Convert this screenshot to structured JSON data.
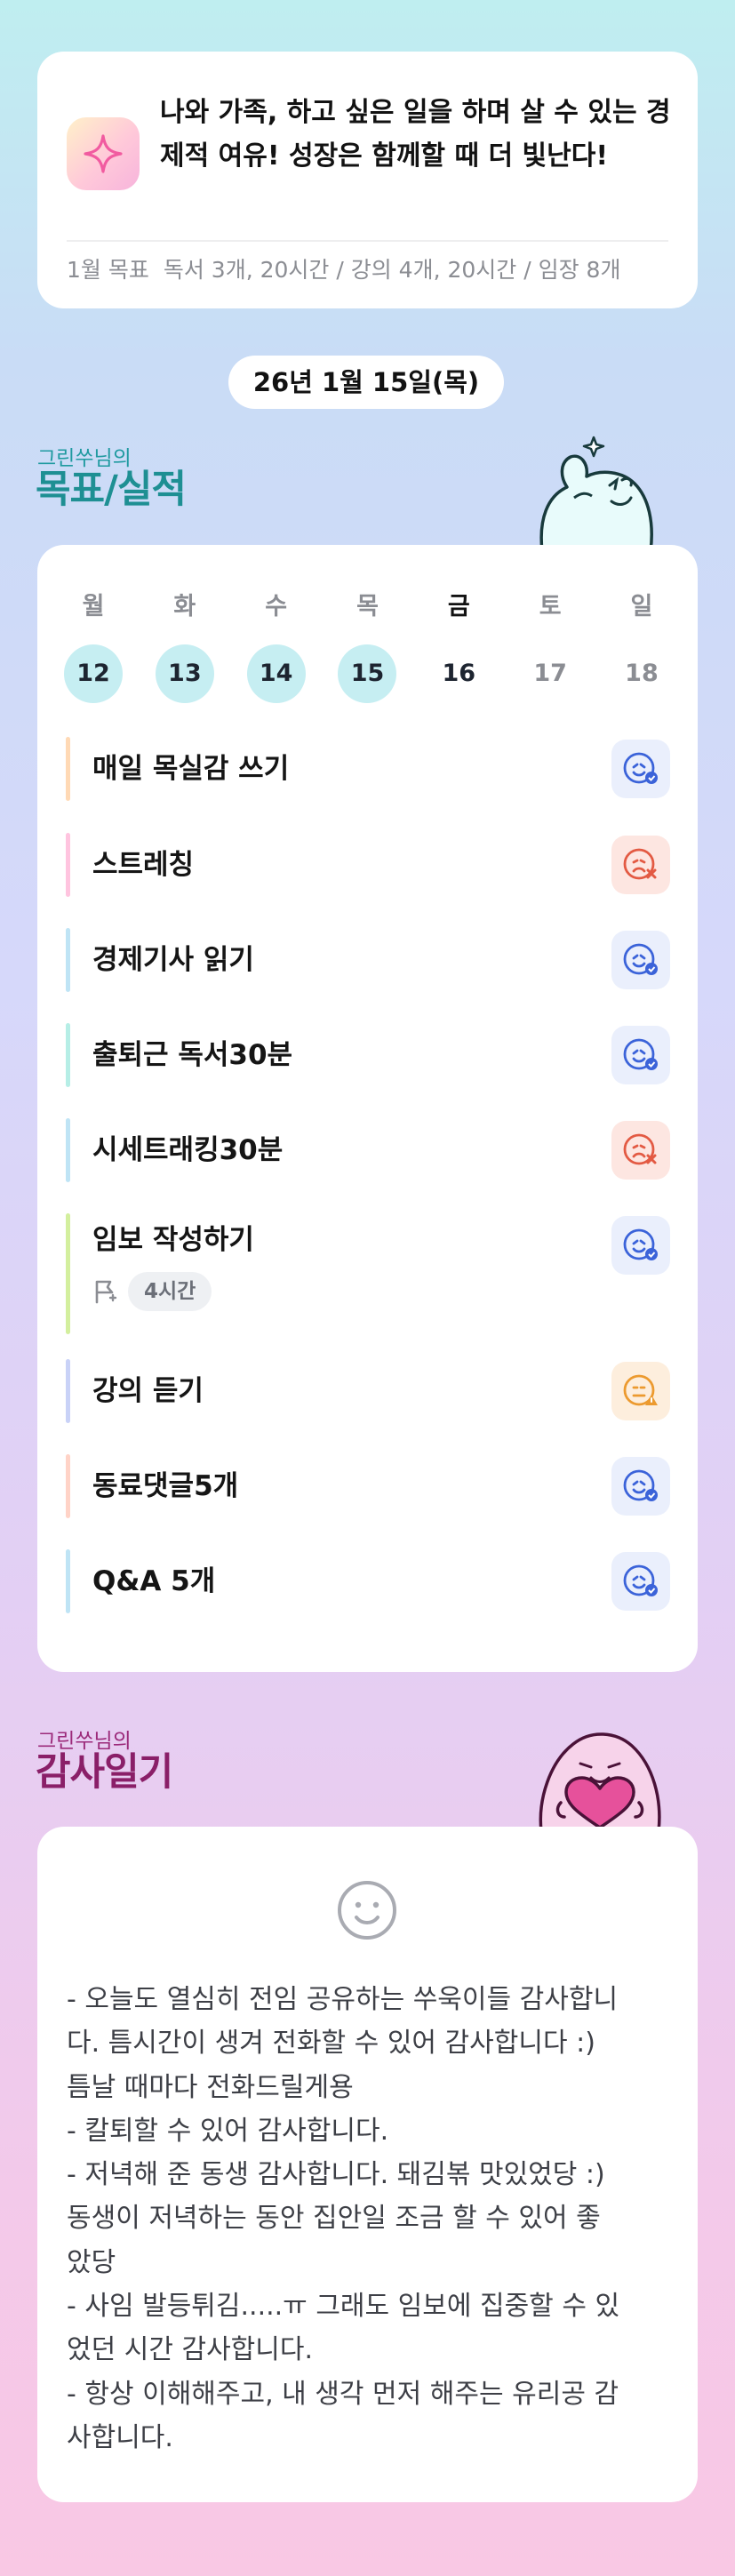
{
  "goal_card": {
    "icon": "sparkle-icon",
    "motto": "나와 가족, 하고 싶은 일을 하며 살 수 있는 경제적 여유! 성장은 함께할 때 더 빛난다!",
    "month_label": "1월 목표",
    "month_goals": "독서 3개, 20시간 / 강의 4개, 20시간 / 임장 8개"
  },
  "date_pill": "26년 1월 15일(목)",
  "goals_section": {
    "subtitle": "그린쑤님의",
    "title": "목표/실적",
    "mascot": "waving-character-icon"
  },
  "week": {
    "days": [
      {
        "name": "월",
        "num": "12",
        "state": "done"
      },
      {
        "name": "화",
        "num": "13",
        "state": "done"
      },
      {
        "name": "수",
        "num": "14",
        "state": "done"
      },
      {
        "name": "목",
        "num": "15",
        "state": "done"
      },
      {
        "name": "금",
        "num": "16",
        "state": "today"
      },
      {
        "name": "토",
        "num": "17",
        "state": "future"
      },
      {
        "name": "일",
        "num": "18",
        "state": "future"
      }
    ]
  },
  "goals": [
    {
      "label": "매일 목실감 쓰기",
      "status": "done",
      "bar_color": "#ffd9b5",
      "status_icon": "smile-check-icon"
    },
    {
      "label": "스트레칭",
      "status": "failed",
      "bar_color": "#ffc4df",
      "status_icon": "sad-x-icon"
    },
    {
      "label": "경제기사 읽기",
      "status": "done",
      "bar_color": "#bfe4f5",
      "status_icon": "smile-check-icon"
    },
    {
      "label": "출퇴근 독서30분",
      "status": "done",
      "bar_color": "#b6eee6",
      "status_icon": "smile-check-icon"
    },
    {
      "label": "시세트래킹30분",
      "status": "failed",
      "bar_color": "#bfe4f5",
      "status_icon": "sad-x-icon"
    },
    {
      "label": "임보 작성하기",
      "status": "done",
      "bar_color": "#d3ef9e",
      "status_icon": "smile-check-icon",
      "time_icon": "flag-icon",
      "time": "4시간"
    },
    {
      "label": "강의 듣기",
      "status": "partial",
      "bar_color": "#c9d2f7",
      "status_icon": "meh-warning-icon"
    },
    {
      "label": "동료댓글5개",
      "status": "done",
      "bar_color": "#ffd3c7",
      "status_icon": "smile-check-icon"
    },
    {
      "label": "Q&A 5개",
      "status": "done",
      "bar_color": "#bfe4f5",
      "status_icon": "smile-check-icon"
    }
  ],
  "gratitude_section": {
    "subtitle": "그린쑤님의",
    "title": "감사일기",
    "mascot": "heart-hugging-character-icon",
    "icon": "smile-outline-icon",
    "lines": [
      "- 오늘도 열심히 전임 공유하는 쑤욱이들 감사합니",
      "다. 틈시간이 생겨 전화할 수 있어 감사합니다 :)",
      "틈날 때마다 전화드릴게용",
      "- 칼퇴할 수 있어 감사합니다.",
      "- 저녁해 준 동생 감사합니다. 돼김볶 맛있었당 :)",
      "동생이 저녁하는 동안 집안일 조금 할 수 있어 좋",
      "았당",
      "- 사임 발등튀김.....ㅠ 그래도 임보에 집중할 수 있",
      "었던 시간 감사합니다.",
      "- 항상 이해해주고, 내 생각 먼저 해주는 유리공 감",
      "사합니다."
    ]
  },
  "colors": {
    "accent_teal": "#1e8f93",
    "accent_purple": "#8a1f68",
    "done_blue": "#3b63d9",
    "fail_red": "#e35a43",
    "warn_orange": "#ec9a2f"
  }
}
